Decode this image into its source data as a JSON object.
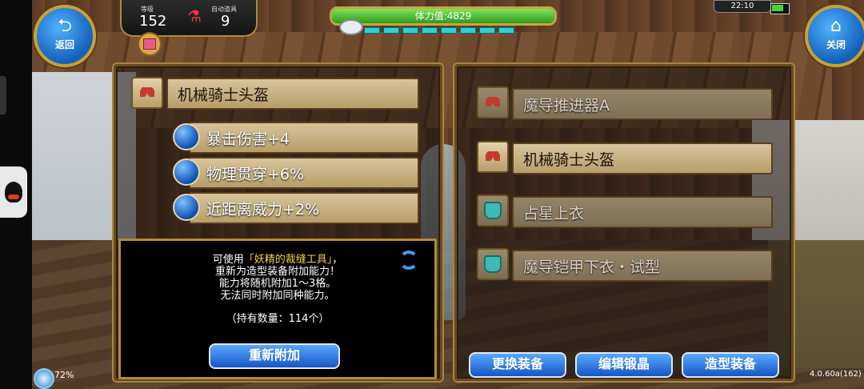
{
  "header": {
    "back_label": "返回",
    "close_label": "关闭",
    "level_label": "等级",
    "level_value": "152",
    "auto_items_label": "自动道具",
    "auto_items_value": "9",
    "stamina_text": "体力值:4829",
    "stamina_fraction": 1.0,
    "exp_segments": 8,
    "clock": "22:10",
    "battery_fraction": 0.8
  },
  "left_panel": {
    "item_name": "机械骑士头盔",
    "abilities": [
      "暴击伤害+4",
      "物理贯穿+6%",
      "近距离威力+2%"
    ],
    "info": {
      "line1_prefix": "可使用",
      "line1_item": "「妖精的裁缝工具」",
      "line1_suffix": "，",
      "line2": "重新为造型装备附加能力！",
      "line3": "能力将随机附加1～3格。",
      "line4": "无法同时附加同种能力。",
      "owned": "（持有数量：114个）",
      "reapply_label": "重新附加"
    }
  },
  "right_panel": {
    "items": [
      {
        "name": "魔导推进器A",
        "icon": "bow-icon",
        "dim": true
      },
      {
        "name": "机械骑士头盔",
        "icon": "bow-icon",
        "dim": false
      },
      {
        "name": "占星上衣",
        "icon": "armor-icon",
        "dim": true
      },
      {
        "name": "魔导铠甲下衣・试型",
        "icon": "armor-icon",
        "dim": true
      }
    ]
  },
  "bottom_buttons": {
    "change_equip": "更换装备",
    "edit_crystal": "编辑锻晶",
    "style_equip": "造型装备"
  },
  "footer": {
    "load_percent": "72%",
    "version": "4.0.60a(162)"
  },
  "colors": {
    "accent_gold": "#c8a03c",
    "button_blue": "#1656c6",
    "highlight_yellow": "#f3cf45",
    "stamina_green": "#2f9a1c"
  }
}
